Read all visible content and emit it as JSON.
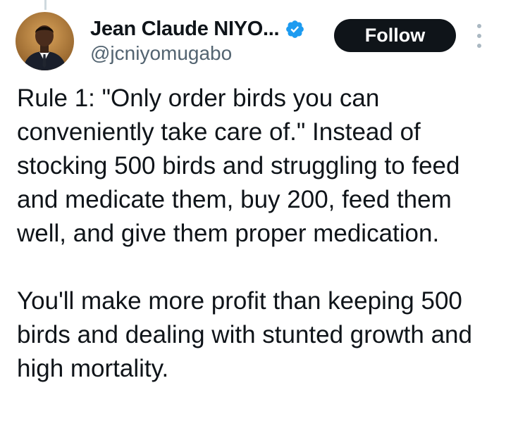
{
  "author": {
    "display_name": "Jean Claude NIYO...",
    "handle": "@jcniyomugabo",
    "verified": true
  },
  "actions": {
    "follow_label": "Follow"
  },
  "tweet": {
    "paragraph_1": "Rule 1: \"Only order birds you can conveniently take care of.\" Instead of stocking 500 birds and struggling to feed and medicate them, buy 200, feed them well, and give them proper medication.",
    "paragraph_2": "You'll make more profit than keeping 500 birds and dealing with stunted growth and high mortality."
  },
  "colors": {
    "text": "#0f1419",
    "secondary": "#536471",
    "verified": "#1d9bf0",
    "follow_bg": "#0f1419"
  },
  "icons": [
    "verified-icon",
    "more-options-icon"
  ]
}
